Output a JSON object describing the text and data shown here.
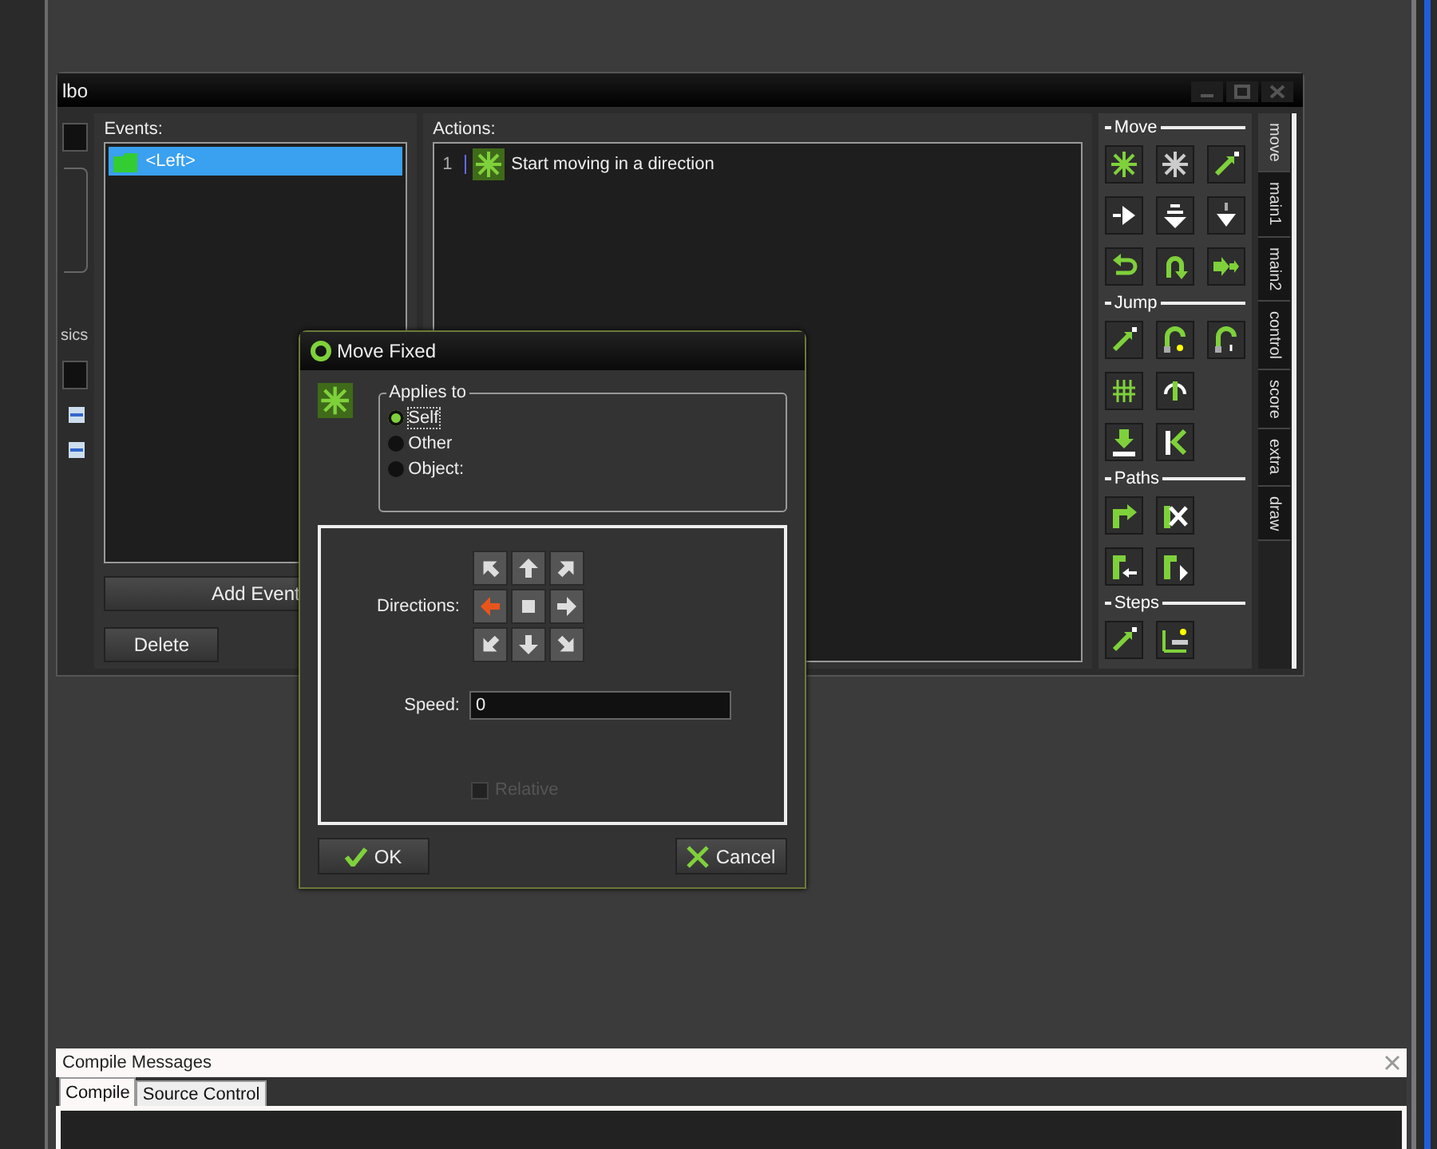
{
  "window": {
    "title": "lbo"
  },
  "side_stub": {
    "label": "sics"
  },
  "events": {
    "label": "Events:",
    "items": [
      {
        "label": "<Left>",
        "selected": true
      }
    ],
    "buttons": [
      {
        "label": "Add Event"
      },
      {
        "label": "Delete"
      }
    ]
  },
  "actions": {
    "label": "Actions:",
    "items": [
      {
        "number": "1",
        "label": "Start moving in a direction",
        "selected": false
      }
    ]
  },
  "palette": {
    "groups": [
      {
        "title": "Move",
        "actions": [
          {
            "kind": "asterisk"
          },
          {
            "kind": "asterisk-grey"
          },
          {
            "kind": "diagonal"
          },
          {
            "kind": "right"
          },
          {
            "kind": "down"
          },
          {
            "kind": "down-small"
          },
          {
            "kind": "undo"
          },
          {
            "kind": "uturn"
          },
          {
            "kind": "double-right"
          }
        ]
      },
      {
        "title": "Jump",
        "actions": [
          {
            "kind": "diagonal"
          },
          {
            "kind": "hook"
          },
          {
            "kind": "hook-q"
          },
          {
            "kind": "grid"
          },
          {
            "kind": "loop"
          },
          {
            "kind": "empty"
          },
          {
            "kind": "down-bar"
          },
          {
            "kind": "k"
          }
        ]
      },
      {
        "title": "Paths",
        "actions": [
          {
            "kind": "path"
          },
          {
            "kind": "path-x"
          },
          {
            "kind": "empty"
          },
          {
            "kind": "path-left"
          },
          {
            "kind": "path-right"
          }
        ]
      },
      {
        "title": "Steps",
        "actions": [
          {
            "kind": "diagonal"
          },
          {
            "kind": "steps"
          }
        ]
      }
    ]
  },
  "tabs": [
    {
      "label": "move",
      "selected": true
    },
    {
      "label": "main1",
      "selected": false
    },
    {
      "label": "main2",
      "selected": false
    },
    {
      "label": "control",
      "selected": false
    },
    {
      "label": "score",
      "selected": false
    },
    {
      "label": "extra",
      "selected": false
    },
    {
      "label": "draw",
      "selected": false
    }
  ],
  "dialog": {
    "title": "Move Fixed",
    "applies_to": {
      "label": "Applies to",
      "options": [
        {
          "label": "Self",
          "selected": true
        },
        {
          "label": "Other",
          "selected": false
        },
        {
          "label": "Object:",
          "selected": false
        }
      ]
    },
    "directions": {
      "label": "Directions:",
      "buttons": [
        {
          "kind": "up-left",
          "selected": false
        },
        {
          "kind": "up",
          "selected": false
        },
        {
          "kind": "up-right",
          "selected": false
        },
        {
          "kind": "left",
          "selected": true
        },
        {
          "kind": "stop",
          "selected": false
        },
        {
          "kind": "right",
          "selected": false
        },
        {
          "kind": "down-left",
          "selected": false
        },
        {
          "kind": "down",
          "selected": false
        },
        {
          "kind": "down-right",
          "selected": false
        }
      ]
    },
    "speed": {
      "label": "Speed:",
      "value": "0"
    },
    "relative": {
      "label": "Relative",
      "checked": false,
      "disabled": true
    },
    "buttons": [
      {
        "kind": "ok",
        "label": "OK"
      },
      {
        "kind": "cancel",
        "label": "Cancel"
      }
    ]
  },
  "compile_panel": {
    "title": "Compile Messages",
    "tabs": [
      {
        "label": "Compile",
        "selected": true
      },
      {
        "label": "Source Control",
        "selected": false
      }
    ]
  }
}
